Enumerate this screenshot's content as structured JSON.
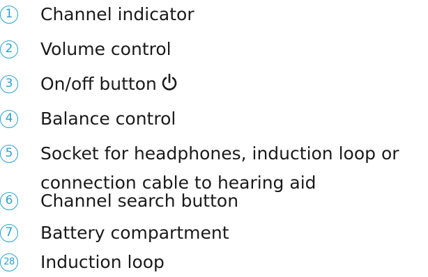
{
  "legend": {
    "items": [
      {
        "number": "1",
        "label": "Channel indicator"
      },
      {
        "number": "2",
        "label": "Volume control"
      },
      {
        "number": "3",
        "label": "On/off button",
        "icon": "power-icon"
      },
      {
        "number": "4",
        "label": "Balance control"
      },
      {
        "number": "5",
        "label": "Socket for headphones, induction loop or",
        "label_line2": "connection cable to hearing aid"
      },
      {
        "number": "6",
        "label": "Channel search button"
      },
      {
        "number": "7",
        "label": "Battery compartment"
      },
      {
        "number": "28",
        "label": "Induction loop"
      }
    ],
    "accent_color": "#2aa2cc"
  }
}
